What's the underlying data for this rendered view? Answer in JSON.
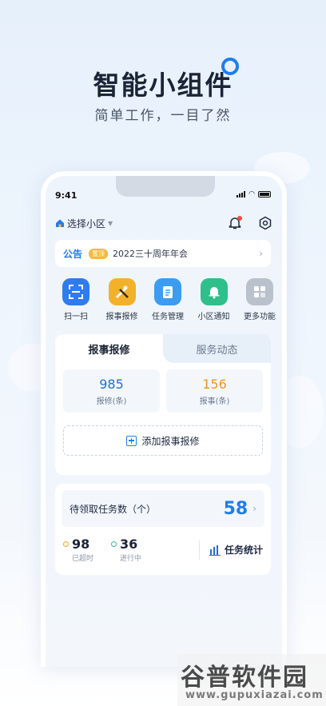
{
  "hero": {
    "title": "智能小组件",
    "subtitle": "简单工作，一目了然"
  },
  "status_bar": {
    "time": "9:41"
  },
  "topbar": {
    "community_label": "选择小区",
    "icons": [
      "home-icon",
      "caret-down-icon",
      "bell-icon",
      "settings-icon"
    ]
  },
  "notice": {
    "title": "公告",
    "tag": "置顶",
    "text": "2022三十周年年会"
  },
  "quick_actions": [
    {
      "label": "扫一扫",
      "icon": "scan-icon",
      "color": "#2f7bf0"
    },
    {
      "label": "报事报修",
      "icon": "tools-icon",
      "color": "#f3b12a"
    },
    {
      "label": "任务管理",
      "icon": "task-icon",
      "color": "#3b9cf2"
    },
    {
      "label": "小区通知",
      "icon": "bell-icon",
      "color": "#2fbf8a"
    },
    {
      "label": "更多功能",
      "icon": "grid-icon",
      "color": "#b9c1cc"
    }
  ],
  "repair_card": {
    "tabs": [
      "报事报修",
      "服务动态"
    ],
    "stats": [
      {
        "value": "985",
        "label": "报修(条)",
        "color": "#1f6fd6"
      },
      {
        "value": "156",
        "label": "报事(条)",
        "color": "#f0961e"
      }
    ],
    "add_label": "添加报事报修"
  },
  "task_card": {
    "pending_label": "待领取任务数（个）",
    "pending_value": "58",
    "mini": [
      {
        "value": "98",
        "label": "已超时",
        "color": "#f0a429"
      },
      {
        "value": "36",
        "label": "进行中",
        "color": "#2fbf8a"
      }
    ],
    "stats_link": "任务统计"
  },
  "watermark": {
    "main": "谷普软件园",
    "sub": "www.gupuxiazai.com"
  }
}
